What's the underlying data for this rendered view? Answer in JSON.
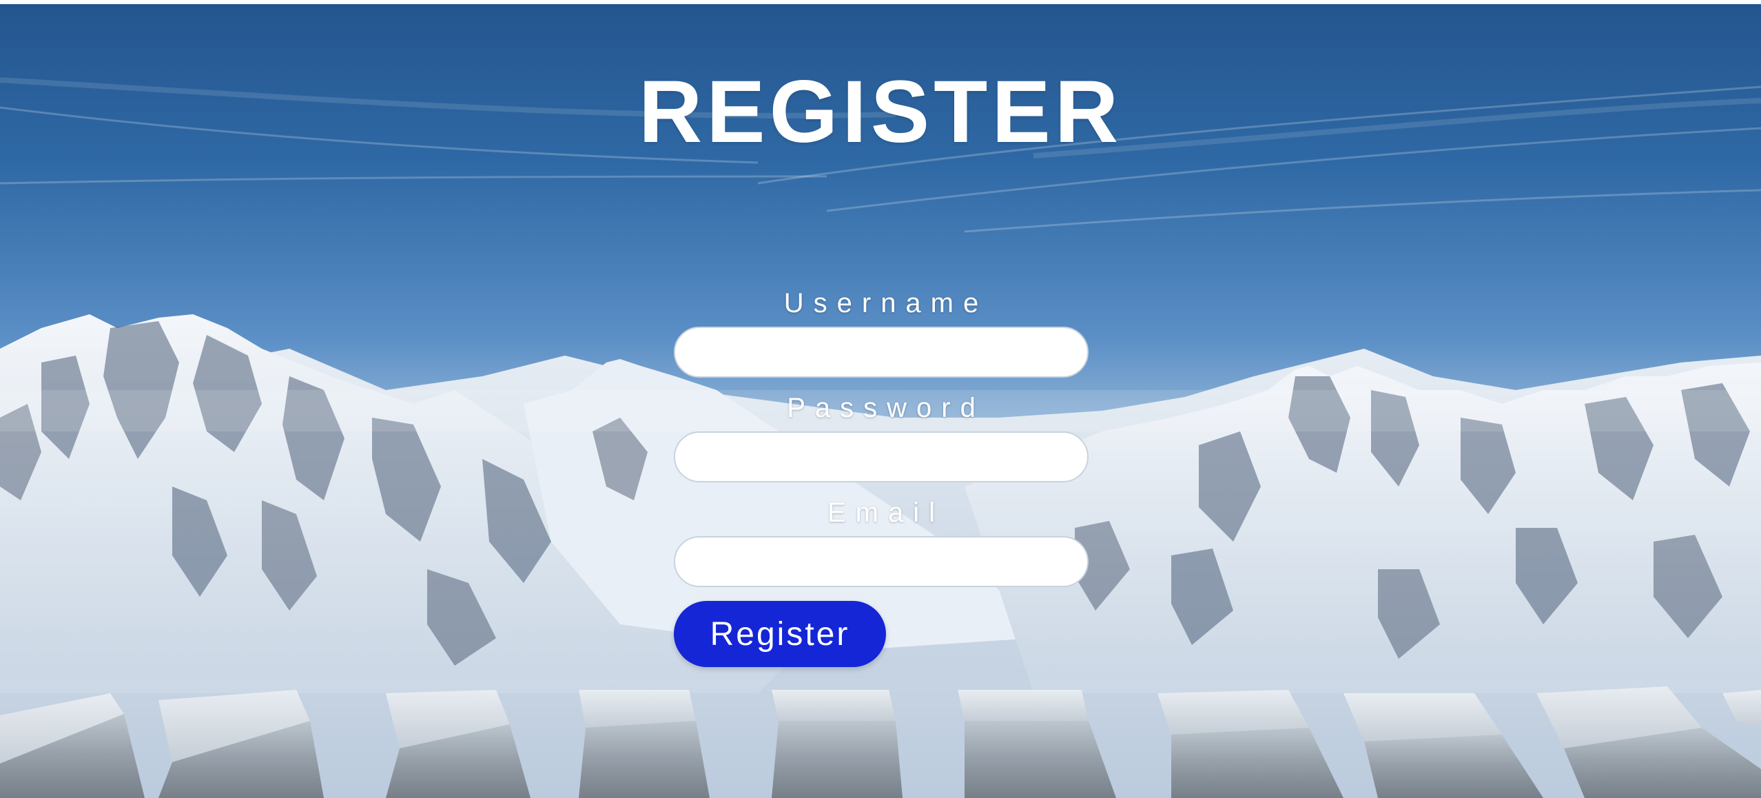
{
  "page": {
    "title": "REGISTER"
  },
  "form": {
    "username_label": "Username",
    "username_value": "",
    "password_label": "Password",
    "password_value": "",
    "email_label": "Email",
    "email_value": "",
    "submit_label": "Register"
  },
  "colors": {
    "button_bg": "#1426d6",
    "text": "#ffffff",
    "sky_top": "#26568f",
    "snow": "#eef2f7"
  },
  "background": {
    "icon": "snowy-mountain-landscape"
  }
}
